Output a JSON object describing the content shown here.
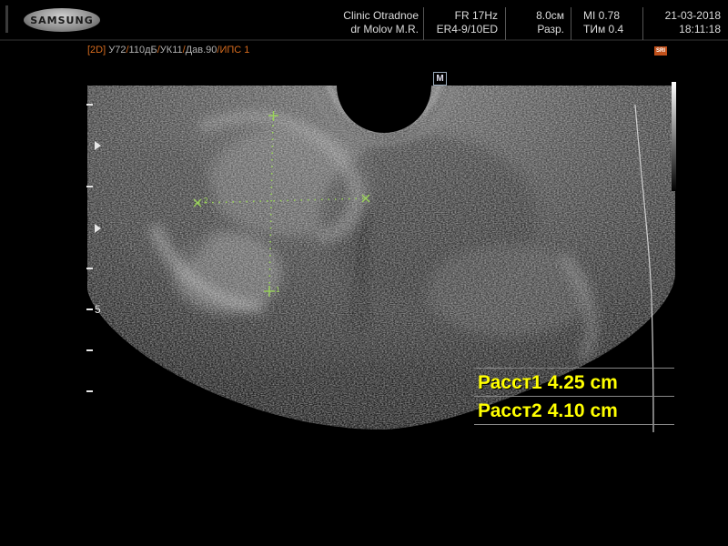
{
  "header": {
    "brand": "SAMSUNG",
    "clinic": "Clinic  Otradnoe",
    "doctor": "dr Molov M.R.",
    "frame_rate": "FR 17Hz",
    "probe": "ER4-9/10ED",
    "depth": "8.0см",
    "resolution": "Разр.",
    "mi": "MI  0.78",
    "tim": "TИм 0.4",
    "date": "21-03-2018",
    "time": "18:11:18"
  },
  "mode_bar": {
    "mode": "[2D]",
    "params": [
      "У72",
      "110дБ",
      "УК11",
      "Дав.90",
      "ИПС 1"
    ],
    "seps": [
      "/",
      "/",
      "/",
      "/"
    ]
  },
  "markers": {
    "orientation": "M",
    "sri": "SRI",
    "depth_label": "5",
    "cursor_1": "1",
    "cursor_2": "2"
  },
  "measurements": [
    {
      "label": "Расст1",
      "value": "4.25 cm"
    },
    {
      "label": "Расст2",
      "value": "4.10 cm"
    }
  ],
  "colors": {
    "measure_text": "#ffff00",
    "caliper": "#9bd45a",
    "mode_accent": "#d46a1e"
  }
}
